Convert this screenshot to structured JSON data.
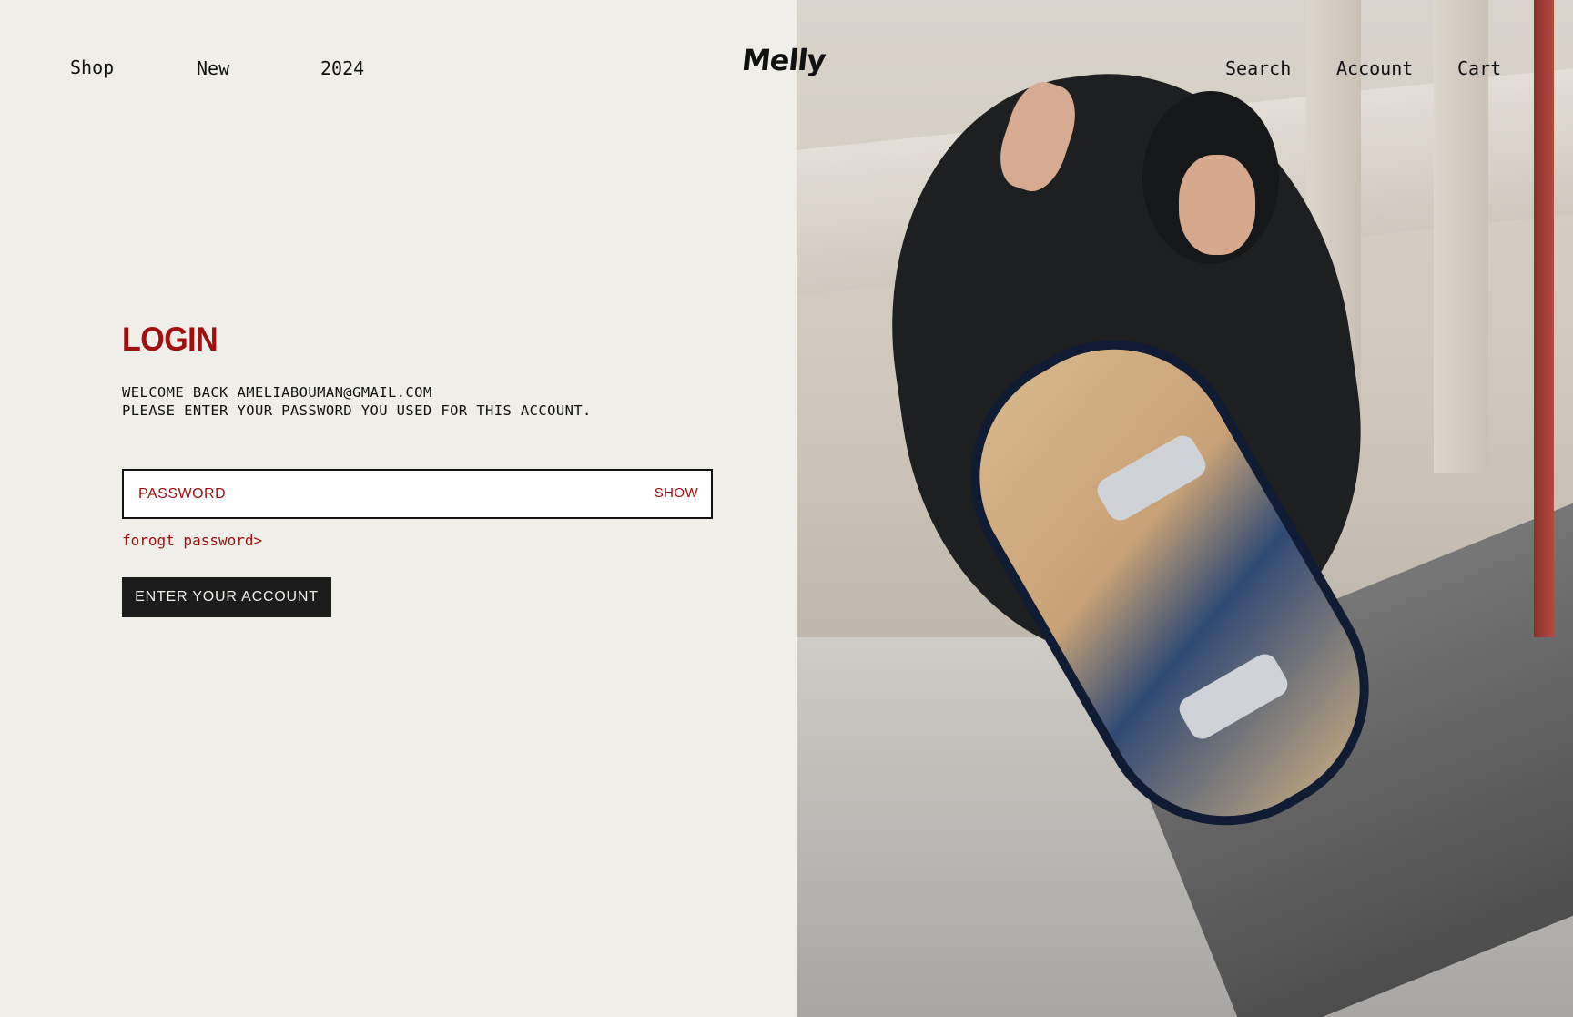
{
  "header": {
    "nav_left": [
      "Shop",
      "New",
      "2024"
    ],
    "logo": "Melly",
    "nav_right": [
      "Search",
      "Account",
      "Cart"
    ]
  },
  "login": {
    "title": "LOGIN",
    "welcome_line": "WELCOME BACK AMELIABOUMAN@GMAIL.COM",
    "instruction_line": "PLEASE ENTER YOUR PASSWORD YOU USED FOR THIS ACCOUNT.",
    "password_placeholder": "PASSWORD",
    "password_value": "",
    "show_label": "SHOW",
    "forgot_label": "forogt password>",
    "submit_label": "ENTER YOUR ACCOUNT"
  },
  "colors": {
    "background": "#f0eee9",
    "accent": "#a01010",
    "button_bg": "#1c1c1c",
    "text": "#111111"
  }
}
